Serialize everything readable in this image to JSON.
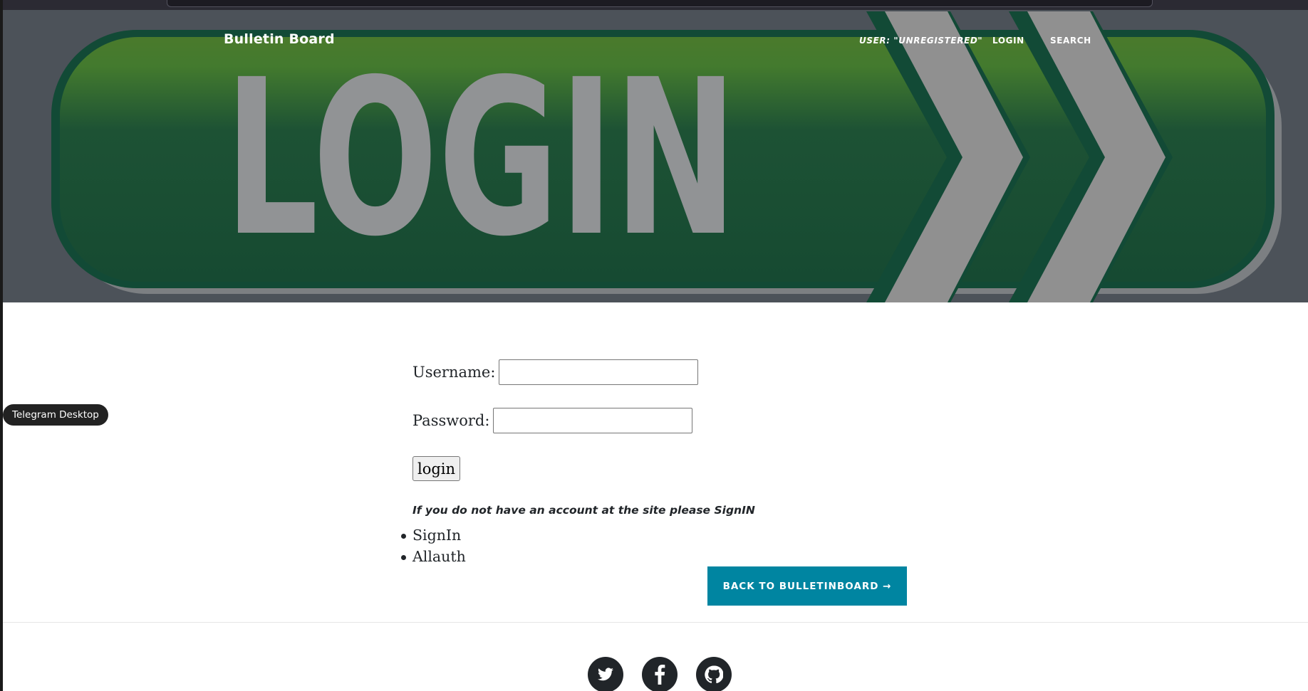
{
  "header": {
    "brand": "Bulletin Board",
    "nav": {
      "user": "USER: \"UNREGISTERED\"",
      "login": "LOGIN",
      "search": "SEARCH"
    },
    "banner_text": "LOGIN"
  },
  "form": {
    "username_label": "Username:",
    "username_value": "",
    "password_label": "Password:",
    "password_value": "",
    "submit_label": "login",
    "note": "If you do not have an account at the site please SignIN",
    "links": [
      "SignIn",
      "Allauth"
    ]
  },
  "back_button": "BACK TO BULLETINBOARD →",
  "social": [
    "twitter-icon",
    "facebook-icon",
    "github-icon"
  ],
  "tooltip": "Telegram Desktop",
  "colors": {
    "banner_green_top": "#4a7a2c",
    "banner_green_bottom": "#174a33",
    "chevron_gray": "#909090",
    "back_button": "#0085a1"
  }
}
